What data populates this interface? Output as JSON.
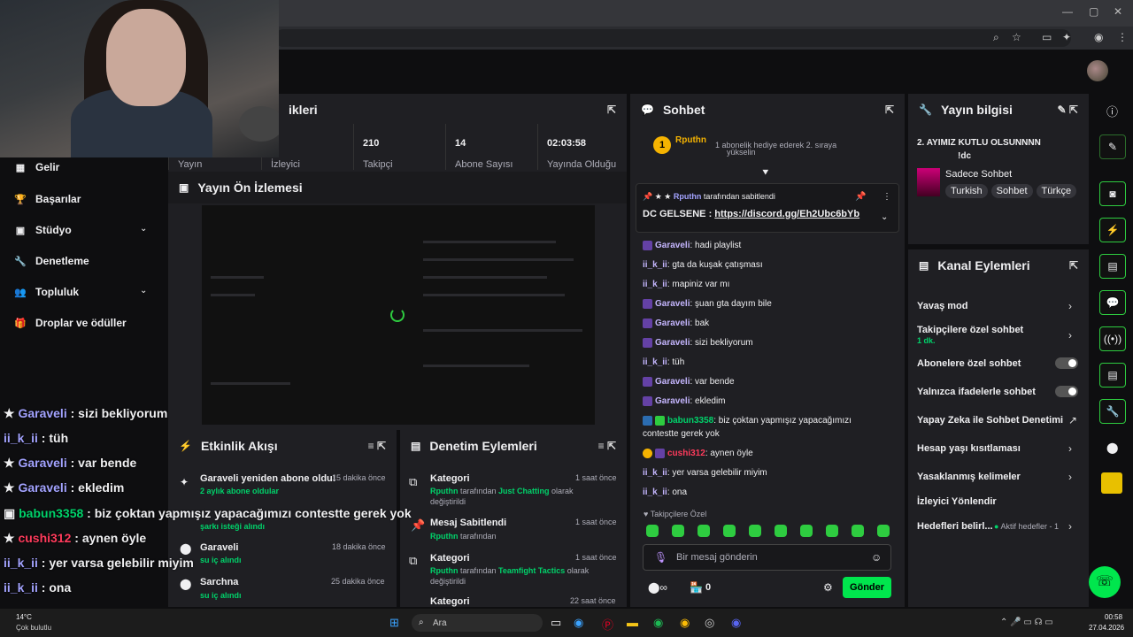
{
  "window": {
    "min": "—",
    "max": "▢",
    "close": "✕"
  },
  "stream_stats": {
    "title_partial": "ikleri",
    "stats": [
      {
        "value": "",
        "label": "Yayın"
      },
      {
        "value": "",
        "label": "İzleyici"
      },
      {
        "value": "210",
        "label": "Takipçi"
      },
      {
        "value": "14",
        "label": "Abone Sayısı"
      },
      {
        "value": "02:03:58",
        "label": "Yayında Olduğu"
      }
    ]
  },
  "nav": {
    "items": [
      {
        "label": "Gelir",
        "icon": "▦"
      },
      {
        "label": "Başarılar",
        "icon": "🏆"
      },
      {
        "label": "Stüdyo",
        "icon": "▣",
        "chevron": "⌄"
      },
      {
        "label": "Denetleme",
        "icon": "🔧"
      },
      {
        "label": "Topluluk",
        "icon": "👥",
        "chevron": "⌄"
      },
      {
        "label": "Droplar ve ödüller",
        "icon": "🎁"
      }
    ]
  },
  "preview": {
    "title": "Yayın Ön İzlemesi"
  },
  "overlay_chat": [
    {
      "user": "Garaveli",
      "text": " : sizi bekliyorum"
    },
    {
      "user": "ii_k_ii",
      "text": " : tüh"
    },
    {
      "user": "Garaveli",
      "text": " : var bende"
    },
    {
      "user": "Garaveli",
      "text": " : ekledim"
    },
    {
      "user": "babun3358",
      "text": " : biz çoktan yapmışız yapacağımızı contestte gerek yok",
      "color": "#00d26a"
    },
    {
      "user": "cushi312",
      "text": " : aynen öyle",
      "color": "#ff3b5c"
    },
    {
      "user": "ii_k_ii",
      "text": " : yer varsa gelebilir miyim"
    },
    {
      "user": "ii_k_ii",
      "text": " : ona"
    }
  ],
  "activity": {
    "title": "Etkinlik Akışı",
    "items": [
      {
        "title": "Garaveli yeniden abone oldu!",
        "sub": "2 aylık abone oldular",
        "time": "15 dakika önce"
      },
      {
        "title": "",
        "sub": "şarkı isteği alındı",
        "time": ""
      },
      {
        "title": "Garaveli",
        "sub": "su iç alındı",
        "time": "18 dakika önce"
      },
      {
        "title": "Sarchna",
        "sub": "su iç alındı",
        "time": "25 dakika önce"
      }
    ]
  },
  "moderation": {
    "title": "Denetim Eylemleri",
    "items": [
      {
        "title": "Kategori",
        "time": "1 saat önce",
        "l1a": "Rputhn",
        "l1b": " tarafından ",
        "l1c": "Just Chatting",
        "l1d": " olarak",
        "l2": "değiştirildi"
      },
      {
        "title": "Mesaj Sabitlendi",
        "time": "1 saat önce",
        "l1a": "Rputhn",
        "l1b": " tarafından",
        "l1c": "",
        "l1d": "",
        "l2": ""
      },
      {
        "title": "Kategori",
        "time": "1 saat önce",
        "l1a": "Rputhn",
        "l1b": " tarafından ",
        "l1c": "Teamfight Tactics",
        "l1d": " olarak",
        "l2": "değiştirildi"
      },
      {
        "title": "Kategori",
        "time": "22 saat önce",
        "l1a": "",
        "l1b": "",
        "l1c": "",
        "l1d": "",
        "l2": ""
      }
    ]
  },
  "chat": {
    "title": "Sohbet",
    "hype_user": "Rputhn",
    "hype_count": "1",
    "gift_text": "1 abonelik hediye ederek 2. sıraya",
    "gift_text2": "yükselin",
    "pinned_by": "Rputhn",
    "pinned_suffix": " tarafından sabitlendi",
    "pinned_text": "DC GELSENE : ",
    "pinned_link": "https://discord.gg/Eh2Ubc6bYb",
    "messages": [
      {
        "user": "Garaveli",
        "text": ": hadi playlist"
      },
      {
        "user": "ii_k_ii",
        "text": ": gta da kuşak çatışması"
      },
      {
        "user": "ii_k_ii",
        "text": ": mapiniz var mı"
      },
      {
        "user": "Garaveli",
        "text": ": şuan gta dayım bile"
      },
      {
        "user": "Garaveli",
        "text": ": bak"
      },
      {
        "user": "Garaveli",
        "text": ": sizi bekliyorum"
      },
      {
        "user": "ii_k_ii",
        "text": ": tüh"
      },
      {
        "user": "Garaveli",
        "text": ": var bende"
      },
      {
        "user": "Garaveli",
        "text": ": ekledim"
      },
      {
        "user": "babun3358",
        "text": ": biz çoktan yapmışız yapacağımızı"
      },
      {
        "user": "",
        "text": "contestte gerek yok"
      },
      {
        "user": "cushi312",
        "text": ": aynen öyle"
      },
      {
        "user": "ii_k_ii",
        "text": ": yer varsa gelebilir miyim"
      },
      {
        "user": "ii_k_ii",
        "text": ": ona"
      }
    ],
    "followers_only": "Takipçilere Özel",
    "placeholder": "Bir mesaj gönderin",
    "points": "0",
    "send": "Gönder"
  },
  "stream_info": {
    "title": "Yayın bilgisi",
    "stream_title": "2. AYIMIZ KUTLU OLSUNNNN",
    "stream_title2": "!dc",
    "category": "Sadece Sohbet",
    "tags": [
      "Turkish",
      "Sohbet",
      "Türkçe"
    ]
  },
  "channel_actions": {
    "title": "Kanal Eylemleri",
    "items": [
      {
        "label": "Yavaş mod",
        "sub": ""
      },
      {
        "label": "Takipçilere özel sohbet",
        "sub": "1 dk."
      },
      {
        "label": "Abonelere özel sohbet",
        "sub": ""
      },
      {
        "label": "Yalnızca ifadelerle sohbet",
        "sub": ""
      },
      {
        "label": "Yapay Zeka ile Sohbet Denetimi",
        "sub": ""
      },
      {
        "label": "Hesap yaşı kısıtlaması",
        "sub": ""
      },
      {
        "label": "Yasaklanmış kelimeler",
        "sub": ""
      },
      {
        "label": "İzleyici Yönlendir",
        "sub": ""
      },
      {
        "label": "Hedefleri belirl...",
        "sub": ""
      }
    ],
    "goals_status": "Aktif hedefler - 1"
  },
  "taskbar": {
    "temp": "14°C",
    "weather": "Çok bulutlu",
    "search": "Ara",
    "time": "00:58",
    "date": "27.04.2026"
  }
}
